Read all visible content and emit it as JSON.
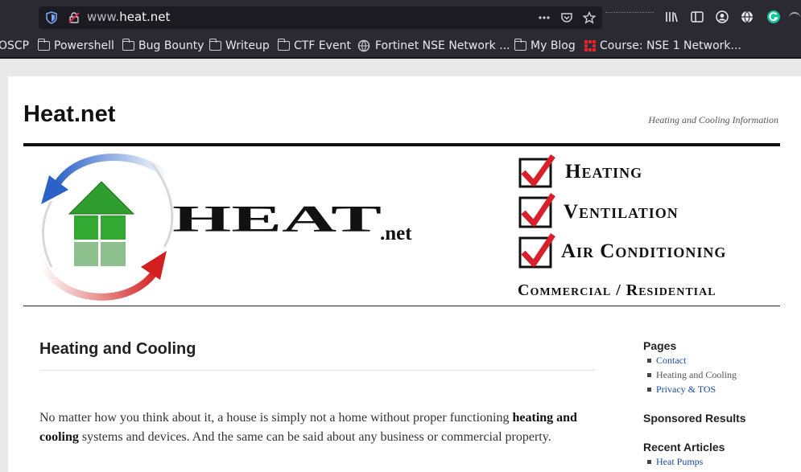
{
  "browser": {
    "url_prefix": "www.",
    "url_domain": "heat.net"
  },
  "bookmarks": [
    {
      "label": "OSCP",
      "icon": "none"
    },
    {
      "label": "Powershell",
      "icon": "folder-icon"
    },
    {
      "label": "Bug Bounty",
      "icon": "folder-icon"
    },
    {
      "label": "Writeup",
      "icon": "folder-icon"
    },
    {
      "label": "CTF Event",
      "icon": "folder-icon"
    },
    {
      "label": "Fortinet NSE Network ...",
      "icon": "globe-icon"
    },
    {
      "label": "My Blog",
      "icon": "folder-icon"
    },
    {
      "label": "Course: NSE 1 Network...",
      "icon": "fortinet-icon"
    }
  ],
  "site": {
    "title": "Heat.net",
    "tagline": "Heating and Cooling Information"
  },
  "banner": {
    "logo_text": "HEAT",
    "logo_suffix": ".net",
    "checklist": [
      "Heating",
      "Ventilation",
      "Air Conditioning"
    ],
    "footer": "Commercial / Residential",
    "colors": {
      "blue_arrow": "#3a6fd0",
      "red_arrow": "#d42a2a",
      "house_green": "#2e9e2e",
      "check_red": "#d81f2a"
    }
  },
  "post": {
    "title": "Heating and Cooling",
    "body_start": "No matter how you think about it, a house is simply not a home without proper functioning ",
    "body_bold": "heating and cooling",
    "body_end": " systems and devices. And the same can be said about any business or commercial property."
  },
  "sidebar": {
    "pages_heading": "Pages",
    "pages": [
      {
        "label": "Contact",
        "link": true
      },
      {
        "label": "Heating and Cooling",
        "link": false
      },
      {
        "label": "Privacy & TOS",
        "link": true
      }
    ],
    "sponsored_heading": "Sponsored Results",
    "recent_heading": "Recent Articles",
    "recent": [
      {
        "label": "Heat Pumps",
        "link": true
      }
    ]
  }
}
